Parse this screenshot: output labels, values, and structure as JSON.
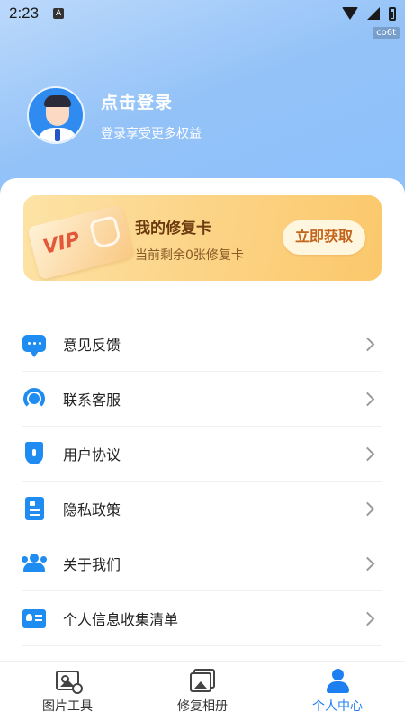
{
  "status_bar": {
    "time": "2:23",
    "notification_glyph": "A",
    "carrier_tag": "co6t"
  },
  "profile": {
    "title": "点击登录",
    "subtitle": "登录享受更多权益"
  },
  "vip_card": {
    "badge_text": "VIP",
    "title": "我的修复卡",
    "subtitle": "当前剩余0张修复卡",
    "action_label": "立即获取"
  },
  "menu": {
    "items": [
      {
        "label": "意见反馈",
        "icon": "chat-bubble-icon"
      },
      {
        "label": "联系客服",
        "icon": "headset-icon"
      },
      {
        "label": "用户协议",
        "icon": "shield-icon"
      },
      {
        "label": "隐私政策",
        "icon": "document-icon"
      },
      {
        "label": "关于我们",
        "icon": "users-icon"
      },
      {
        "label": "个人信息收集清单",
        "icon": "id-card-icon"
      }
    ]
  },
  "tabbar": {
    "tabs": [
      {
        "label": "图片工具",
        "icon": "image-tools-icon",
        "active": false
      },
      {
        "label": "修复相册",
        "icon": "album-icon",
        "active": false
      },
      {
        "label": "个人中心",
        "icon": "person-icon",
        "active": true
      }
    ]
  },
  "colors": {
    "accent": "#1e7ff0",
    "header_gradient_start": "#bcd9fb",
    "header_gradient_end": "#8cc0fb",
    "vip_gradient_start": "#fde3a6",
    "vip_gradient_end": "#fbc86b"
  }
}
